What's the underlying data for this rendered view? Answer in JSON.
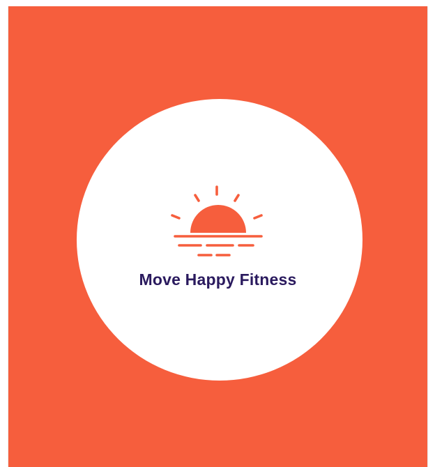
{
  "logo": {
    "icon": "sunrise-icon",
    "brand_name": "Move Happy Fitness"
  },
  "colors": {
    "background": "#F65E3D",
    "circle": "#FFFFFF",
    "icon": "#F65E3D",
    "text": "#2A1A5E",
    "page_margin": "#FFFFFF"
  }
}
